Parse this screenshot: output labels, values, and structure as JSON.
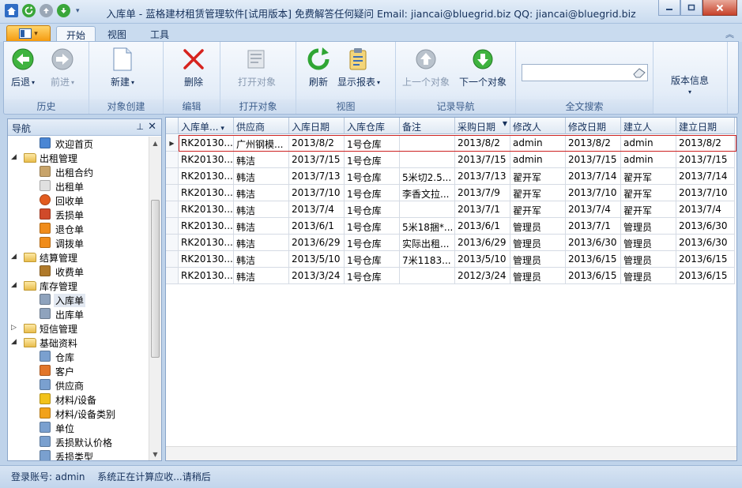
{
  "window": {
    "title": "入库单 - 蓝格建材租赁管理软件[试用版本] 免费解答任何疑问 Email: jiancai@bluegrid.biz QQ: jiancai@bluegrid.biz"
  },
  "ribbon": {
    "tabs": [
      "开始",
      "视图",
      "工具"
    ],
    "groups": {
      "history": {
        "label": "历史",
        "back": "后退",
        "forward": "前进"
      },
      "create": {
        "label": "对象创建",
        "new": "新建"
      },
      "edit": {
        "label": "编辑",
        "delete": "删除"
      },
      "open": {
        "label": "打开对象",
        "open": "打开对象"
      },
      "view": {
        "label": "视图",
        "refresh": "刷新",
        "report": "显示报表"
      },
      "nav": {
        "label": "记录导航",
        "prev": "上一个对象",
        "next": "下一个对象"
      },
      "search": {
        "label": "全文搜索",
        "value": ""
      },
      "version": {
        "label": "版本信息"
      }
    }
  },
  "nav_pane": {
    "title": "导航",
    "items": [
      {
        "label": "欢迎首页",
        "level": 1,
        "icon": "home-icon"
      },
      {
        "label": "出租管理",
        "level": 0,
        "icon": "folder-icon",
        "expanded": true
      },
      {
        "label": "出租合约",
        "level": 1,
        "icon": "contract-icon"
      },
      {
        "label": "出租单",
        "level": 1,
        "icon": "doc-icon"
      },
      {
        "label": "回收单",
        "level": 1,
        "icon": "recycle-icon"
      },
      {
        "label": "丢损单",
        "level": 1,
        "icon": "loss-icon"
      },
      {
        "label": "退仓单",
        "level": 1,
        "icon": "return-icon"
      },
      {
        "label": "调拨单",
        "level": 1,
        "icon": "transfer-icon"
      },
      {
        "label": "结算管理",
        "level": 0,
        "icon": "folder-icon",
        "expanded": true
      },
      {
        "label": "收费单",
        "level": 1,
        "icon": "moneybag-icon"
      },
      {
        "label": "库存管理",
        "level": 0,
        "icon": "folder-icon",
        "expanded": true
      },
      {
        "label": "入库单",
        "level": 1,
        "icon": "database-icon",
        "selected": true
      },
      {
        "label": "出库单",
        "level": 1,
        "icon": "database-icon"
      },
      {
        "label": "短信管理",
        "level": 0,
        "icon": "folder-icon",
        "expanded": false
      },
      {
        "label": "基础资料",
        "level": 0,
        "icon": "folder-icon",
        "expanded": true
      },
      {
        "label": "仓库",
        "level": 1,
        "icon": "form-icon"
      },
      {
        "label": "客户",
        "level": 1,
        "icon": "customer-icon"
      },
      {
        "label": "供应商",
        "level": 1,
        "icon": "form-icon"
      },
      {
        "label": "材料/设备",
        "level": 1,
        "icon": "material-icon"
      },
      {
        "label": "材料/设备类别",
        "level": 1,
        "icon": "category-icon"
      },
      {
        "label": "单位",
        "level": 1,
        "icon": "form-icon"
      },
      {
        "label": "丢损默认价格",
        "level": 1,
        "icon": "form-icon"
      },
      {
        "label": "丢损类型",
        "level": 1,
        "icon": "form-icon"
      }
    ]
  },
  "grid": {
    "columns": [
      "入库单...",
      "供应商",
      "入库日期",
      "入库仓库",
      "备注",
      "采购日期",
      "修改人",
      "修改日期",
      "建立人",
      "建立日期"
    ],
    "rows": [
      [
        "RK20130...",
        "广州钢模...",
        "2013/8/2",
        "1号仓库",
        "",
        "2013/8/2",
        "admin",
        "2013/8/2",
        "admin",
        "2013/8/2"
      ],
      [
        "RK20130...",
        "韩洁",
        "2013/7/15",
        "1号仓库",
        "",
        "2013/7/15",
        "admin",
        "2013/7/15",
        "admin",
        "2013/7/15"
      ],
      [
        "RK20130...",
        "韩洁",
        "2013/7/13",
        "1号仓库",
        "5米切2.5...",
        "2013/7/13",
        "翟开军",
        "2013/7/14",
        "翟开军",
        "2013/7/14"
      ],
      [
        "RK20130...",
        "韩洁",
        "2013/7/10",
        "1号仓库",
        "李香文拉...",
        "2013/7/9",
        "翟开军",
        "2013/7/10",
        "翟开军",
        "2013/7/10"
      ],
      [
        "RK20130...",
        "韩洁",
        "2013/7/4",
        "1号仓库",
        "",
        "2013/7/1",
        "翟开军",
        "2013/7/4",
        "翟开军",
        "2013/7/4"
      ],
      [
        "RK20130...",
        "韩洁",
        "2013/6/1",
        "1号仓库",
        "5米18捆*...",
        "2013/6/1",
        "管理员",
        "2013/7/1",
        "管理员",
        "2013/6/30"
      ],
      [
        "RK20130...",
        "韩洁",
        "2013/6/29",
        "1号仓库",
        "实际出租...",
        "2013/6/29",
        "管理员",
        "2013/6/30",
        "管理员",
        "2013/6/30"
      ],
      [
        "RK20130...",
        "韩洁",
        "2013/5/10",
        "1号仓库",
        "7米1183...",
        "2013/5/10",
        "管理员",
        "2013/6/15",
        "管理员",
        "2013/6/15"
      ],
      [
        "RK20130...",
        "韩洁",
        "2013/3/24",
        "1号仓库",
        "",
        "2012/3/24",
        "管理员",
        "2013/6/15",
        "管理员",
        "2013/6/15"
      ]
    ]
  },
  "status": {
    "account_label": "登录账号: admin",
    "message": "系统正在计算应收...请稍后"
  }
}
